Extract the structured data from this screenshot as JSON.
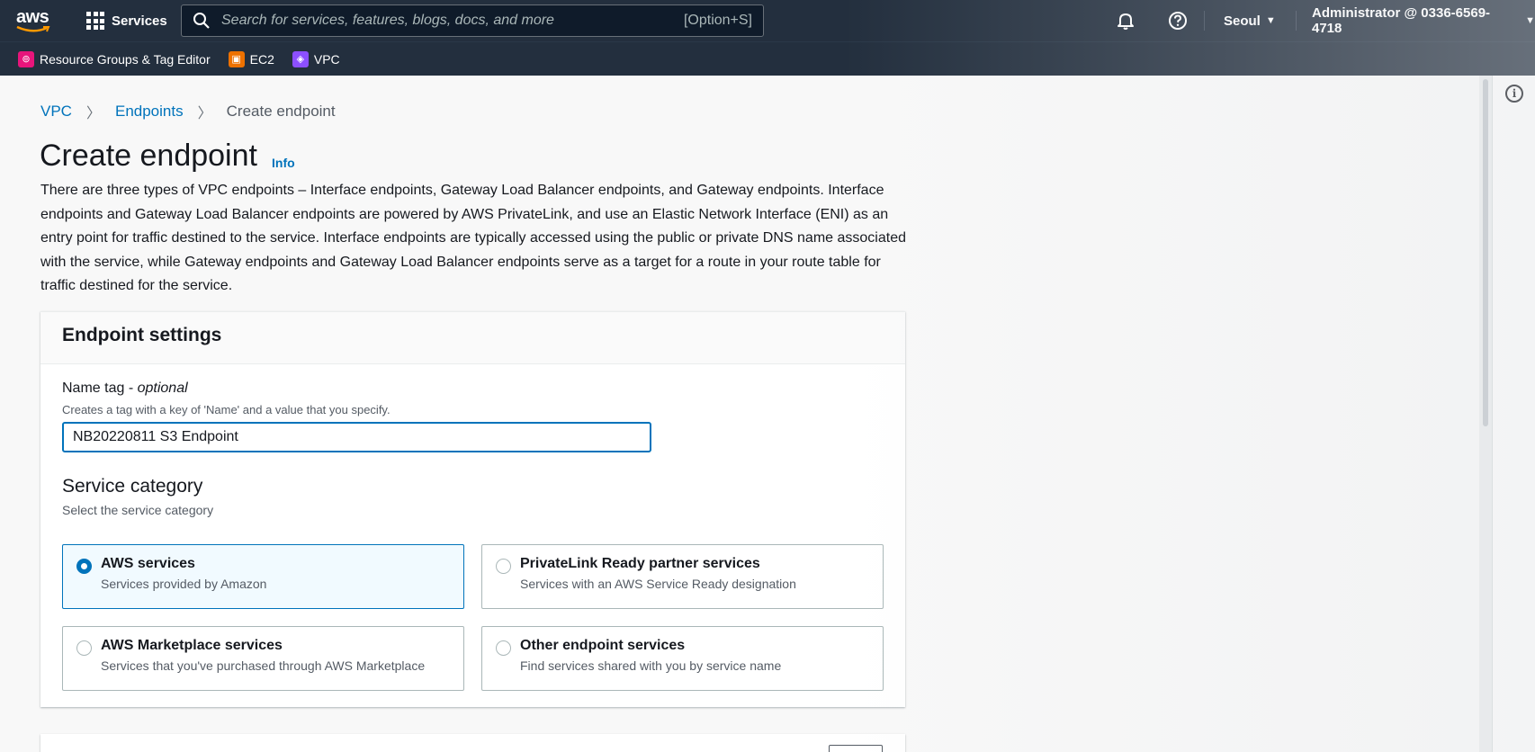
{
  "nav": {
    "logo_text": "aws",
    "services_label": "Services",
    "search_placeholder": "Search for services, features, blogs, docs, and more",
    "search_shortcut": "[Option+S]",
    "region": "Seoul",
    "account": "Administrator @ 0336-6569-4718"
  },
  "favorites": [
    {
      "label": "Resource Groups & Tag Editor",
      "icon": "resource-groups-icon",
      "color": "#e7157b"
    },
    {
      "label": "EC2",
      "icon": "ec2-icon",
      "color": "#ed7100"
    },
    {
      "label": "VPC",
      "icon": "vpc-icon",
      "color": "#8c4fff"
    }
  ],
  "breadcrumb": {
    "items": [
      "VPC",
      "Endpoints"
    ],
    "current": "Create endpoint"
  },
  "page": {
    "title": "Create endpoint",
    "info": "Info",
    "description": "There are three types of VPC endpoints – Interface endpoints, Gateway Load Balancer endpoints, and Gateway endpoints. Interface endpoints and Gateway Load Balancer endpoints are powered by AWS PrivateLink, and use an Elastic Network Interface (ENI) as an entry point for traffic destined to the service. Interface endpoints are typically accessed using the public or private DNS name associated with the service, while Gateway endpoints and Gateway Load Balancer endpoints serve as a target for a route in your route table for traffic destined for the service."
  },
  "settings": {
    "heading": "Endpoint settings",
    "name_tag_label": "Name tag - ",
    "name_tag_optional": "optional",
    "name_tag_desc": "Creates a tag with a key of 'Name' and a value that you specify.",
    "name_tag_value": "NB20220811 S3 Endpoint",
    "service_category_title": "Service category",
    "service_category_desc": "Select the service category",
    "options": [
      {
        "title": "AWS services",
        "desc": "Services provided by Amazon",
        "selected": true
      },
      {
        "title": "PrivateLink Ready partner services",
        "desc": "Services with an AWS Service Ready designation",
        "selected": false
      },
      {
        "title": "AWS Marketplace services",
        "desc": "Services that you've purchased through AWS Marketplace",
        "selected": false
      },
      {
        "title": "Other endpoint services",
        "desc": "Find services shared with you by service name",
        "selected": false
      }
    ]
  },
  "colors": {
    "nav_bg": "#232f3e",
    "link": "#0073bb",
    "selected_tile_bg": "#f1faff"
  }
}
